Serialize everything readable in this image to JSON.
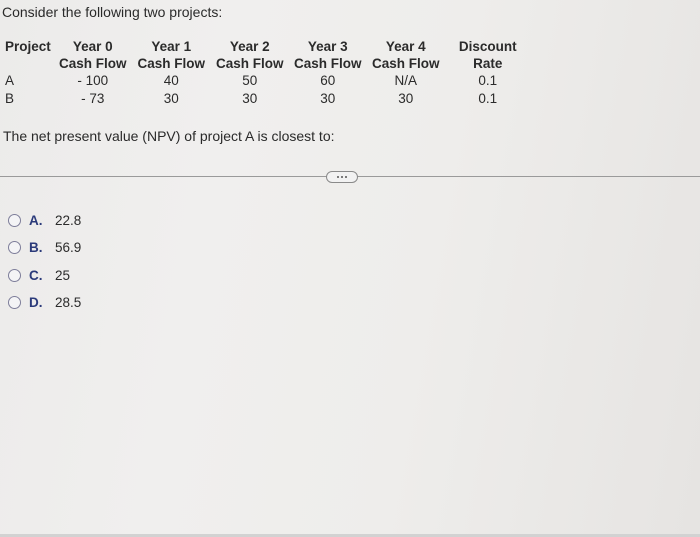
{
  "intro": "Consider the following two projects:",
  "table": {
    "headers": [
      {
        "line1": "Project",
        "line2": ""
      },
      {
        "line1": "Year 0",
        "line2": "Cash Flow"
      },
      {
        "line1": "Year 1",
        "line2": "Cash Flow"
      },
      {
        "line1": "Year 2",
        "line2": "Cash Flow"
      },
      {
        "line1": "Year 3",
        "line2": "Cash Flow"
      },
      {
        "line1": "Year 4",
        "line2": "Cash Flow"
      },
      {
        "line1": "Discount",
        "line2": "Rate"
      }
    ],
    "rows": [
      [
        "A",
        "- 100",
        "40",
        "50",
        "60",
        "N/A",
        "0.1"
      ],
      [
        "B",
        "- 73",
        "30",
        "30",
        "30",
        "30",
        "0.1"
      ]
    ]
  },
  "question": "The net present value (NPV) of project A is closest to:",
  "more_button_label": "...",
  "options": [
    {
      "letter": "A.",
      "value": "22.8"
    },
    {
      "letter": "B.",
      "value": "56.9"
    },
    {
      "letter": "C.",
      "value": "25"
    },
    {
      "letter": "D.",
      "value": "28.5"
    }
  ]
}
